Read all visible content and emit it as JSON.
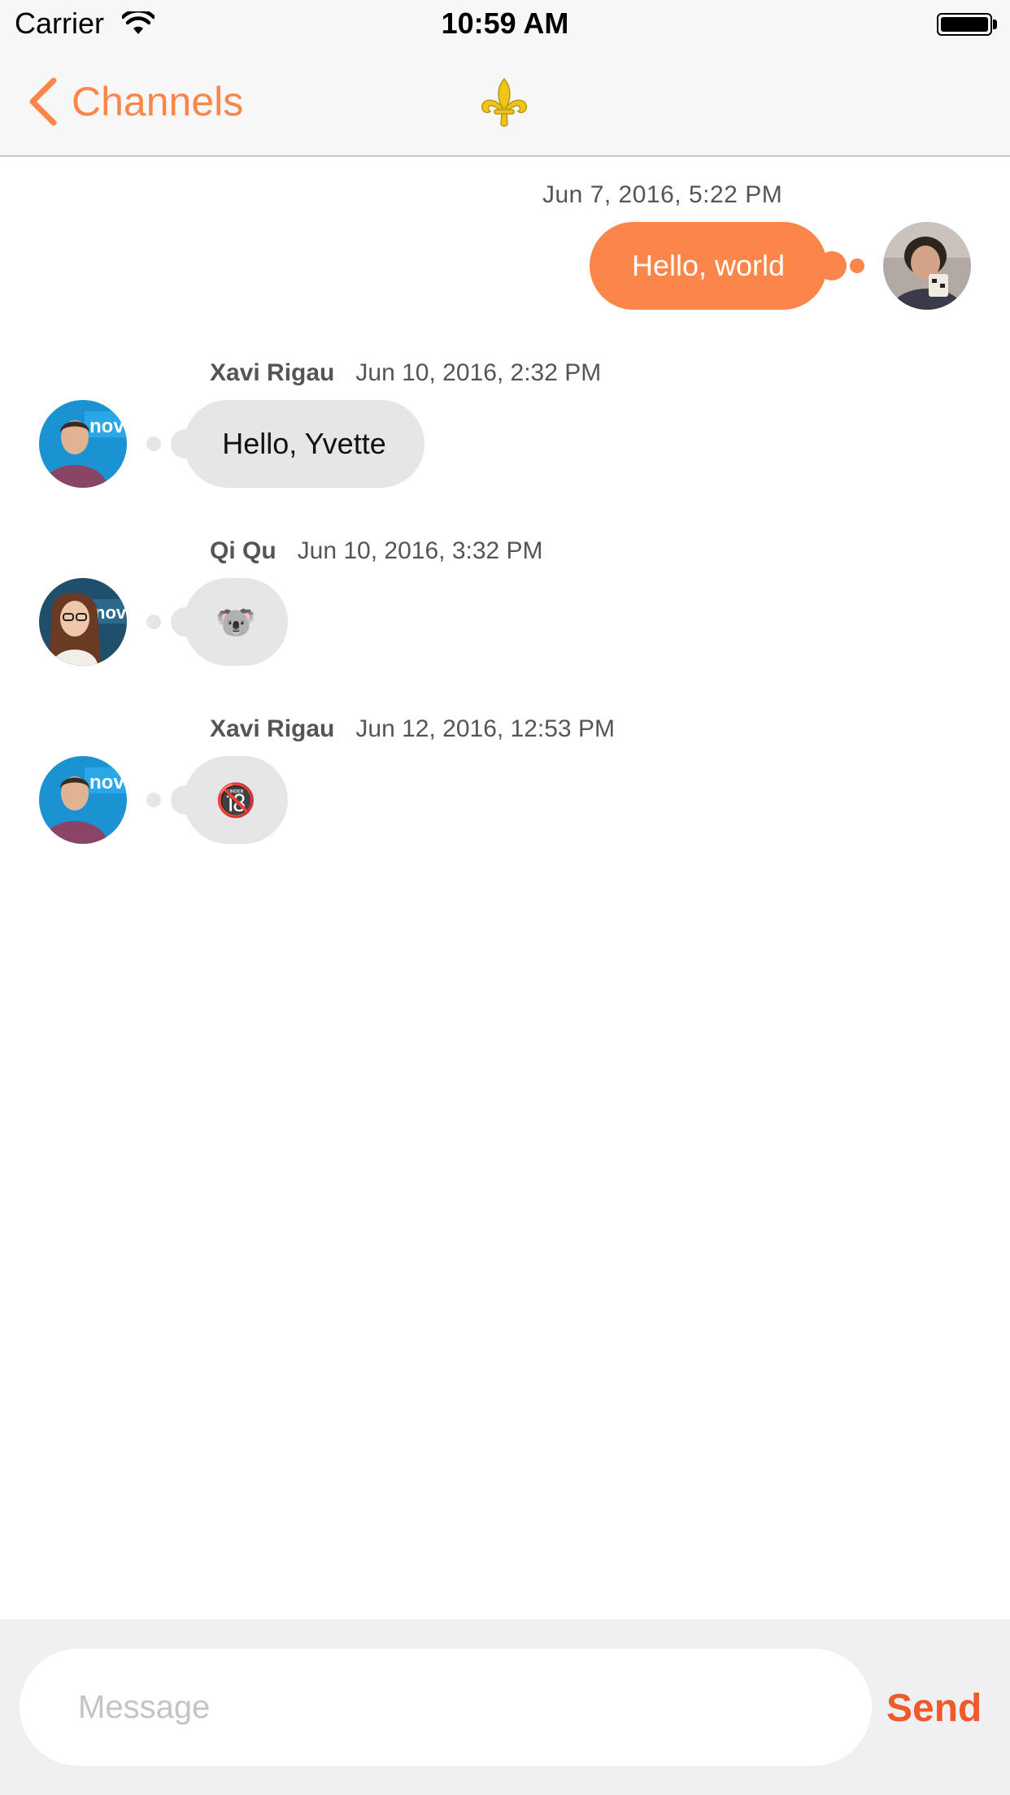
{
  "status_bar": {
    "carrier": "Carrier",
    "time": "10:59 AM",
    "wifi_icon": "wifi-icon",
    "battery_icon": "battery-icon"
  },
  "nav": {
    "back_label": "Channels",
    "back_icon": "chevron-left-icon",
    "logo_icon": "fleur-de-lis-icon"
  },
  "messages": [
    {
      "direction": "outgoing",
      "timestamp": "Jun 7, 2016, 5:22 PM",
      "text": "Hello, world"
    },
    {
      "direction": "incoming",
      "sender": "Xavi Rigau",
      "timestamp": "Jun 10, 2016, 2:32 PM",
      "text": "Hello, Yvette"
    },
    {
      "direction": "incoming",
      "sender": "Qi Qu",
      "timestamp": "Jun 10, 2016, 3:32 PM",
      "text": "🐨"
    },
    {
      "direction": "incoming",
      "sender": "Xavi Rigau",
      "timestamp": "Jun 12, 2016, 12:53 PM",
      "text": "🔞"
    }
  ],
  "composer": {
    "placeholder": "Message",
    "value": "",
    "send_label": "Send"
  },
  "colors": {
    "accent": "#fc8649",
    "send": "#f05a2a",
    "incoming_bubble": "#e6e6e6",
    "logo": "#f0c419"
  }
}
